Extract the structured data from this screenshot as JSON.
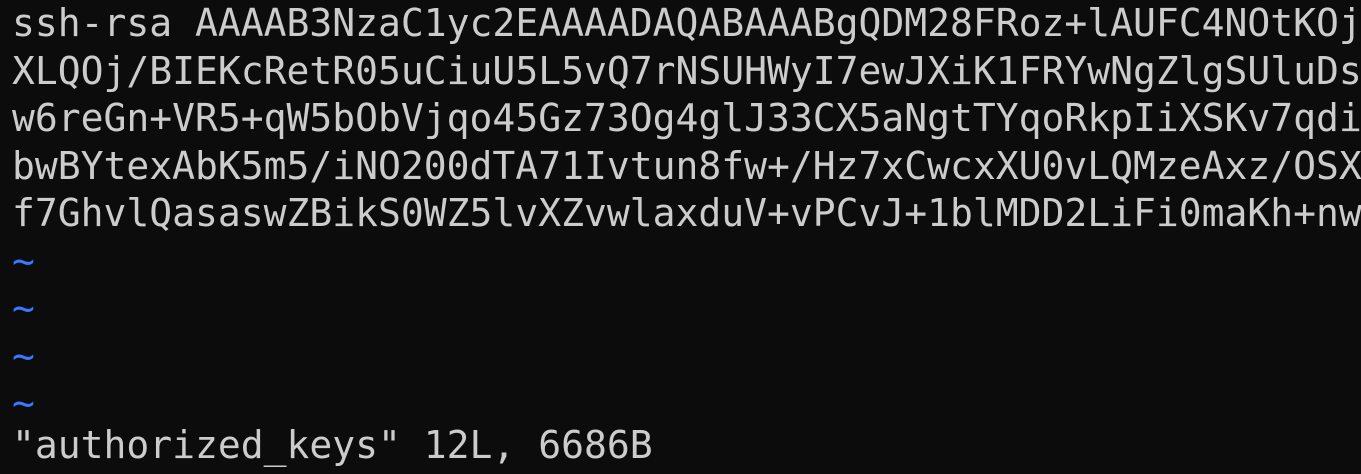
{
  "buffer": {
    "lines": [
      "ssh-rsa AAAAB3NzaC1yc2EAAAADAQABAAABgQDM28FRoz+lAUFC4NOtKOj",
      "XLQOj/BIEKcRetR05uCiuU5L5vQ7rNSUHWyI7ewJXiK1FRYwNgZlgSUluDs",
      "w6reGn+VR5+qW5bObVjqo45Gz73Og4glJ33CX5aNgtTYqoRkpIiXSKv7qdi",
      "bwBYtexAbK5m5/iNO200dTA71Ivtun8fw+/Hz7xCwcxXU0vLQMzeAxz/OSX",
      "f7GhvlQasaswZBikS0WZ5lvXZvwlaxduV+vPCvJ+1blMDD2LiFi0maKh+nw"
    ],
    "empty_line_markers": [
      "~",
      "~",
      "~",
      "~"
    ]
  },
  "status_line": "\"authorized_keys\" 12L, 6686B",
  "colors": {
    "background": "#0c0c0c",
    "text": "#cccccc",
    "tilde": "#3b78ff"
  }
}
